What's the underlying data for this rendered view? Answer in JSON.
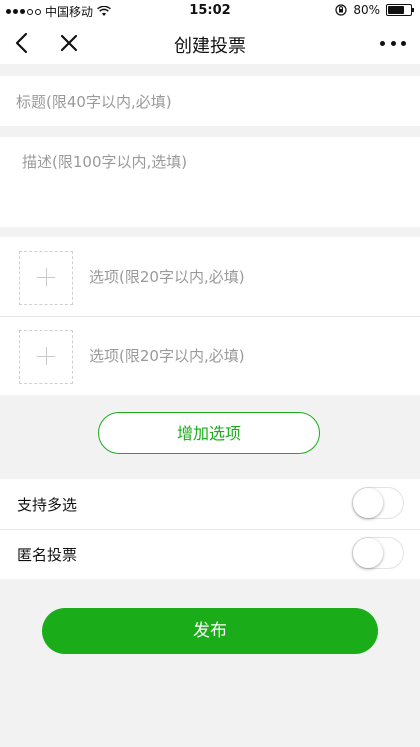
{
  "status_bar": {
    "carrier": "中国移动",
    "time": "15:02",
    "battery": "80%",
    "battery_level": 0.8
  },
  "nav": {
    "title": "创建投票"
  },
  "form": {
    "title_placeholder": "标题(限40字以内,必填)",
    "description_placeholder": "描述(限100字以内,选填)",
    "options": [
      {
        "placeholder": "选项(限20字以内,必填)"
      },
      {
        "placeholder": "选项(限20字以内,必填)"
      }
    ],
    "add_option_label": "增加选项"
  },
  "settings": {
    "multi_select": {
      "label": "支持多选",
      "enabled": false
    },
    "anonymous": {
      "label": "匿名投票",
      "enabled": false
    }
  },
  "publish_label": "发布",
  "colors": {
    "accent": "#1aad19",
    "background": "#f2f2f2",
    "placeholder": "#9a9a9a"
  }
}
